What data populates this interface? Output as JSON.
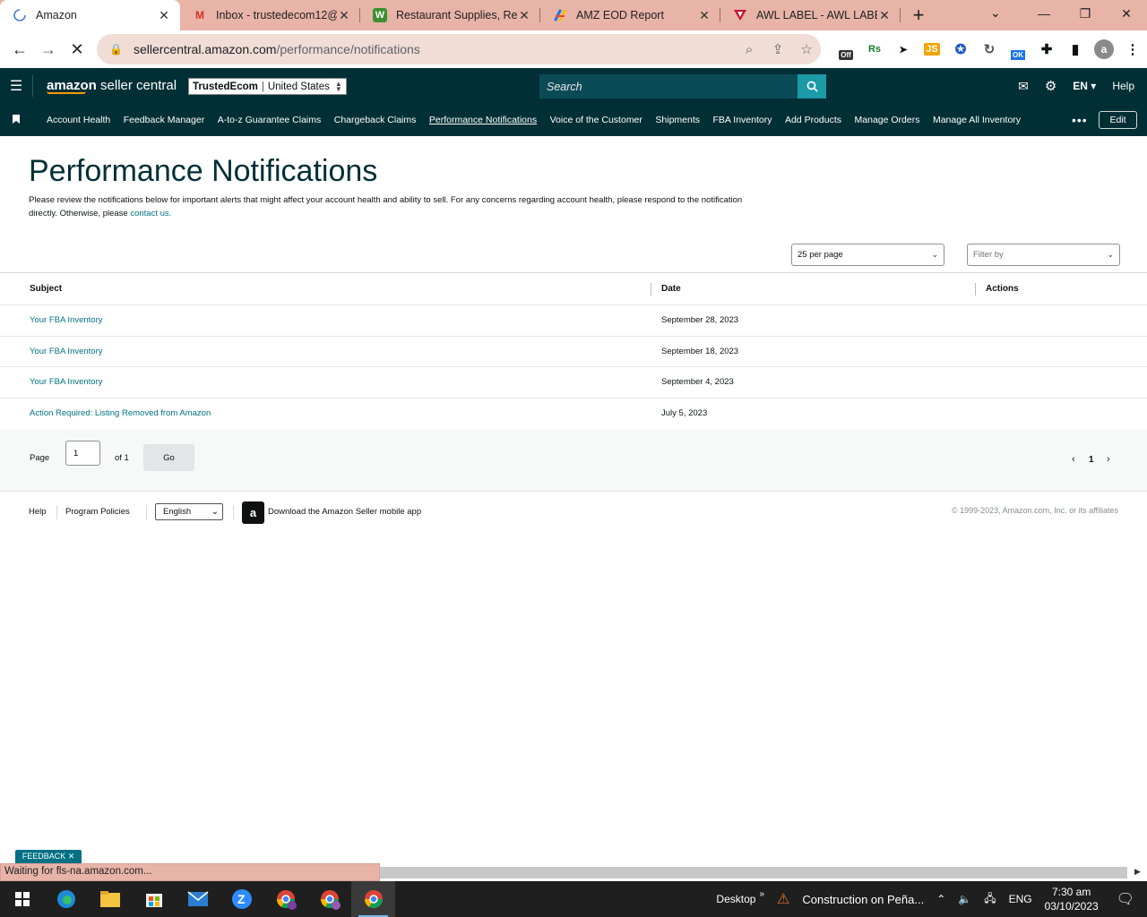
{
  "browser": {
    "tabs": [
      {
        "title": "Amazon",
        "icon": "loading-spinner-icon",
        "active": true
      },
      {
        "title": "Inbox - trustedecom12@",
        "icon": "gmail-icon",
        "active": false
      },
      {
        "title": "Restaurant Supplies, Rest",
        "icon": "webstaurant-icon",
        "active": false
      },
      {
        "title": "AMZ EOD Report",
        "icon": "apps-script-icon",
        "active": false
      },
      {
        "title": "AWL LABEL - AWL LABEL",
        "icon": "awl-icon",
        "active": false
      }
    ],
    "url_host": "sellercentral.amazon.com",
    "url_path": "/performance/notifications",
    "extension_labels": [
      "Off",
      "Rs",
      "JS",
      "OK"
    ],
    "profile_initial": "a"
  },
  "header": {
    "logo_bold": "amazon",
    "logo_rest": " seller central",
    "account_name": "TrustedEcom",
    "account_region": "United States",
    "search_placeholder": "Search",
    "language": "EN",
    "help": "Help"
  },
  "nav": {
    "items": [
      "Account Health",
      "Feedback Manager",
      "A-to-z Guarantee Claims",
      "Chargeback Claims",
      "Performance Notifications",
      "Voice of the Customer",
      "Shipments",
      "FBA Inventory",
      "Add Products",
      "Manage Orders",
      "Manage All Inventory"
    ],
    "more": "•••",
    "edit": "Edit"
  },
  "page": {
    "title": "Performance Notifications",
    "intro": "Please review the notifications below for important alerts that might affect your account health and ability to sell. For any concerns regarding account health, please respond to the notification directly. Otherwise, please ",
    "contact_link": "contact us.",
    "per_page": "25 per page",
    "filter_placeholder": "Filter by"
  },
  "table": {
    "headers": [
      "Subject",
      "Date",
      "Actions"
    ],
    "rows": [
      {
        "subject": "Your FBA Inventory",
        "date": "September 28, 2023",
        "actions": ""
      },
      {
        "subject": "Your FBA Inventory",
        "date": "September 18, 2023",
        "actions": ""
      },
      {
        "subject": "Your FBA Inventory",
        "date": "September 4, 2023",
        "actions": ""
      },
      {
        "subject": "Action Required: Listing Removed from Amazon",
        "date": "July 5, 2023",
        "actions": ""
      }
    ]
  },
  "pagination": {
    "page_label": "Page",
    "current_page": "1",
    "of_label": "of 1",
    "go": "Go",
    "page_number": "1"
  },
  "footer": {
    "help": "Help",
    "policies": "Program Policies",
    "language": "English",
    "app_text": "Download the Amazon Seller mobile app",
    "copyright": "© 1999-2023, Amazon.com, Inc. or its affiliates"
  },
  "feedback": "FEEDBACK ✕",
  "status_text": "Waiting for fls-na.amazon.com...",
  "taskbar": {
    "desktop": "Desktop",
    "notification": "Construction on Peña...",
    "lang": "ENG",
    "time": "7:30 am",
    "date": "03/10/2023"
  },
  "colors": {
    "header_bg": "#002f36",
    "link": "#007185",
    "tab_strip": "#e8b4a8"
  }
}
